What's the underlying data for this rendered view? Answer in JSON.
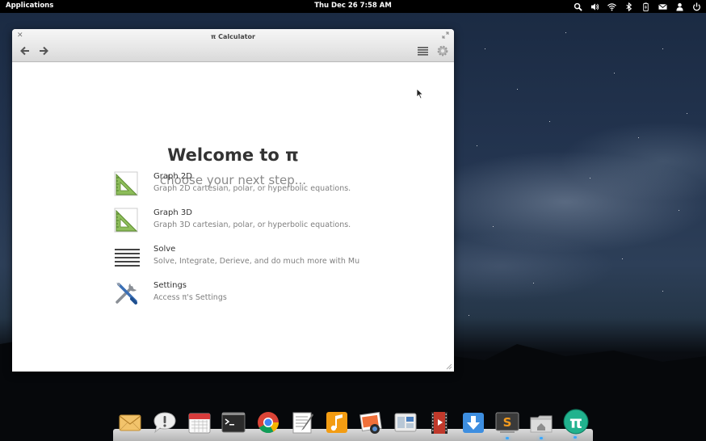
{
  "panel": {
    "applications_label": "Applications",
    "clock": "Thu Dec 26  7:58 AM",
    "indicators": [
      "search-icon",
      "volume-icon",
      "wifi-icon",
      "bluetooth-icon",
      "battery-icon",
      "mail-icon",
      "user-icon",
      "power-icon"
    ]
  },
  "window": {
    "title": "π Calculator",
    "heading": "Welcome to π",
    "subheading": "choose your next step...",
    "options": [
      {
        "title": "Graph 2D",
        "description": "Graph 2D cartesian, polar, or hyperbolic equations.",
        "icon": "set-square-icon"
      },
      {
        "title": "Graph 3D",
        "description": "Graph 3D cartesian, polar, or hyperbolic equations.",
        "icon": "set-square-icon"
      },
      {
        "title": "Solve",
        "description": "Solve, Integrate, Derieve, and do much more with Mu",
        "icon": "lines-icon"
      },
      {
        "title": "Settings",
        "description": "Access π's Settings",
        "icon": "tools-icon"
      }
    ]
  },
  "dock": {
    "items": [
      "mail-app-icon",
      "notifications-app-icon",
      "calendar-app-icon",
      "terminal-app-icon",
      "chrome-app-icon",
      "text-editor-app-icon",
      "music-app-icon",
      "photos-app-icon",
      "switchboard-app-icon",
      "videos-app-icon",
      "download-app-icon",
      "sublime-text-app-icon",
      "files-app-icon",
      "pi-calculator-app-icon"
    ],
    "pi_glyph": "π",
    "sublime_glyph": "S",
    "accent": "#21b28e"
  }
}
